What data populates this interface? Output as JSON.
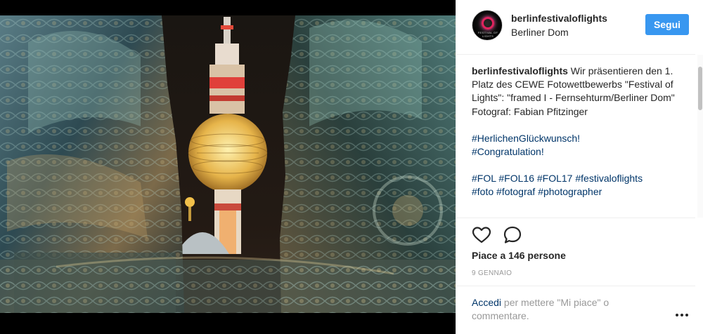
{
  "post": {
    "username": "berlinfestivaloflights",
    "location": "Berliner Dom",
    "follow_label": "Segui",
    "avatar_text": "FESTIVAL OF LIGHTS",
    "caption": {
      "text_1": " Wir präsentieren den 1. Platz des CEWE Fotowettbewerbs \"Festival of Lights\": \"framed I - Fernsehturm/Berliner Dom\"",
      "text_2": "Fotograf: Fabian Pfitzinger",
      "hashtags_1": [
        "#HerlichenGlückwunsch!",
        "#Congratulation!"
      ],
      "hashtags_2": [
        "#FOL",
        "#FOL16",
        "#FOL17",
        "#festivaloflights",
        "#foto",
        "#fotograf",
        "#photographer"
      ]
    },
    "likes_text": "Piace a 146 persone",
    "date": "9 GENNAIO",
    "login": {
      "link": "Accedi",
      "rest": " per mettere \"Mi piace\" o commentare."
    }
  },
  "icons": {
    "like": "heart-outline-icon",
    "comment": "speech-bubble-icon",
    "more": "more-options-icon"
  },
  "colors": {
    "follow_button": "#3897f0",
    "hashtag": "#003569",
    "secondary_text": "#999999"
  }
}
